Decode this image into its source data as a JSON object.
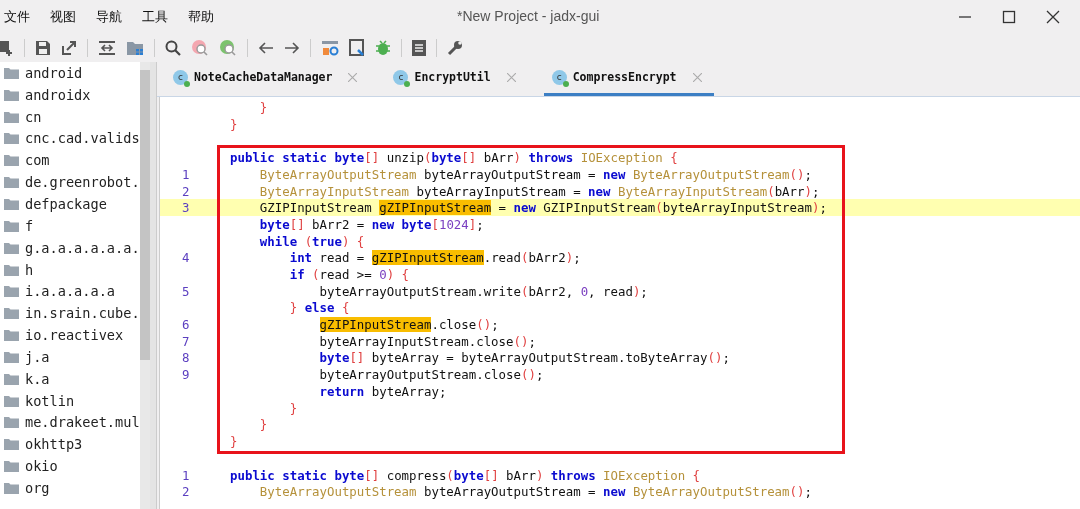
{
  "window": {
    "title": "*New Project - jadx-gui"
  },
  "menu": [
    "文件",
    "视图",
    "导航",
    "工具",
    "帮助"
  ],
  "sidebar": {
    "items": [
      {
        "label": "android"
      },
      {
        "label": "androidx"
      },
      {
        "label": "cn"
      },
      {
        "label": "cnc.cad.valids"
      },
      {
        "label": "com"
      },
      {
        "label": "de.greenrobot."
      },
      {
        "label": "defpackage"
      },
      {
        "label": "f"
      },
      {
        "label": "g.a.a.a.a.a.a."
      },
      {
        "label": "h"
      },
      {
        "label": "i.a.a.a.a.a"
      },
      {
        "label": "in.srain.cube."
      },
      {
        "label": "io.reactivex"
      },
      {
        "label": "j.a"
      },
      {
        "label": "k.a"
      },
      {
        "label": "kotlin"
      },
      {
        "label": "me.drakeet.mul"
      },
      {
        "label": "okhttp3"
      },
      {
        "label": "okio"
      },
      {
        "label": "org"
      }
    ]
  },
  "tabs": [
    {
      "label": "NoteCacheDataManager",
      "icon_letter": "c",
      "selected": false
    },
    {
      "label": "EncryptUtil",
      "icon_letter": "c",
      "selected": false
    },
    {
      "label": "CompressEncrypt",
      "icon_letter": "c",
      "selected": true
    }
  ],
  "code": {
    "lines_before": [
      {
        "current": false,
        "tokens": [
          {
            "kind": "bracket",
            "text": "    }"
          }
        ]
      },
      {
        "current": false,
        "tokens": [
          {
            "kind": "bracket",
            "text": "}"
          }
        ]
      }
    ],
    "annotated_block": {
      "lines": [
        {
          "current": false,
          "tokens": [
            {
              "kind": "keyword",
              "text": "public static byte"
            },
            {
              "kind": "bracket",
              "text": "[]"
            },
            {
              "kind": "plain",
              "text": " unzip"
            },
            {
              "kind": "bracket",
              "text": "("
            },
            {
              "kind": "keyword",
              "text": "byte"
            },
            {
              "kind": "bracket",
              "text": "[]"
            },
            {
              "kind": "plain",
              "text": " bArr"
            },
            {
              "kind": "bracket",
              "text": ")"
            },
            {
              "kind": "keyword",
              "text": " throws"
            },
            {
              "kind": "type",
              "text": " IOException"
            },
            {
              "kind": "bracket",
              "text": " {"
            }
          ]
        },
        {
          "num": "1",
          "current": false,
          "tokens": [
            {
              "kind": "type",
              "text": "    ByteArrayOutputStream"
            },
            {
              "kind": "plain",
              "text": " byteArrayOutputStream = "
            },
            {
              "kind": "keyword",
              "text": "new"
            },
            {
              "kind": "type",
              "text": " ByteArrayOutputStream"
            },
            {
              "kind": "bracket",
              "text": "()"
            },
            {
              "kind": "plain",
              "text": ";"
            }
          ]
        },
        {
          "num": "2",
          "current": false,
          "tokens": [
            {
              "kind": "type",
              "text": "    ByteArrayInputStream"
            },
            {
              "kind": "plain",
              "text": " byteArrayInputStream = "
            },
            {
              "kind": "keyword",
              "text": "new"
            },
            {
              "kind": "type",
              "text": " ByteArrayInputStream"
            },
            {
              "kind": "bracket",
              "text": "("
            },
            {
              "kind": "plain",
              "text": "bArr"
            },
            {
              "kind": "bracket",
              "text": ")"
            },
            {
              "kind": "plain",
              "text": ";"
            }
          ]
        },
        {
          "num": "3",
          "current": true,
          "tokens": [
            {
              "kind": "plain",
              "text": "    GZIPInputStream "
            },
            {
              "kind": "match",
              "text": "gZIPInputStream"
            },
            {
              "kind": "plain",
              "text": " = "
            },
            {
              "kind": "keyword",
              "text": "new"
            },
            {
              "kind": "plain",
              "text": " GZIPInputStream"
            },
            {
              "kind": "bracket",
              "text": "("
            },
            {
              "kind": "plain",
              "text": "byteArrayInputStream"
            },
            {
              "kind": "bracket",
              "text": ")"
            },
            {
              "kind": "plain",
              "text": ";"
            }
          ]
        },
        {
          "current": false,
          "tokens": [
            {
              "kind": "keyword",
              "text": "    byte"
            },
            {
              "kind": "bracket",
              "text": "[]"
            },
            {
              "kind": "plain",
              "text": " bArr2 = "
            },
            {
              "kind": "keyword",
              "text": "new byte"
            },
            {
              "kind": "bracket",
              "text": "["
            },
            {
              "kind": "number",
              "text": "1024"
            },
            {
              "kind": "bracket",
              "text": "]"
            },
            {
              "kind": "plain",
              "text": ";"
            }
          ]
        },
        {
          "current": false,
          "tokens": [
            {
              "kind": "keyword",
              "text": "    while"
            },
            {
              "kind": "bracket",
              "text": " ("
            },
            {
              "kind": "keyword",
              "text": "true"
            },
            {
              "kind": "bracket",
              "text": ") {"
            }
          ]
        },
        {
          "num": "4",
          "current": false,
          "tokens": [
            {
              "kind": "keyword",
              "text": "        int"
            },
            {
              "kind": "plain",
              "text": " read = "
            },
            {
              "kind": "match",
              "text": "gZIPInputStream"
            },
            {
              "kind": "plain",
              "text": ".read"
            },
            {
              "kind": "bracket",
              "text": "("
            },
            {
              "kind": "plain",
              "text": "bArr2"
            },
            {
              "kind": "bracket",
              "text": ")"
            },
            {
              "kind": "plain",
              "text": ";"
            }
          ]
        },
        {
          "current": false,
          "tokens": [
            {
              "kind": "keyword",
              "text": "        if"
            },
            {
              "kind": "bracket",
              "text": " ("
            },
            {
              "kind": "plain",
              "text": "read >= "
            },
            {
              "kind": "number",
              "text": "0"
            },
            {
              "kind": "bracket",
              "text": ") {"
            }
          ]
        },
        {
          "num": "5",
          "current": false,
          "tokens": [
            {
              "kind": "plain",
              "text": "            byteArrayOutputStream.write"
            },
            {
              "kind": "bracket",
              "text": "("
            },
            {
              "kind": "plain",
              "text": "bArr2, "
            },
            {
              "kind": "number",
              "text": "0"
            },
            {
              "kind": "plain",
              "text": ", read"
            },
            {
              "kind": "bracket",
              "text": ")"
            },
            {
              "kind": "plain",
              "text": ";"
            }
          ]
        },
        {
          "current": false,
          "tokens": [
            {
              "kind": "bracket",
              "text": "        }"
            },
            {
              "kind": "keyword",
              "text": " else"
            },
            {
              "kind": "bracket",
              "text": " {"
            }
          ]
        },
        {
          "num": "6",
          "current": false,
          "tokens": [
            {
              "kind": "match",
              "text": "            gZIPInputStream"
            },
            {
              "kind": "plain",
              "text": ".close"
            },
            {
              "kind": "bracket",
              "text": "()"
            },
            {
              "kind": "plain",
              "text": ";"
            }
          ]
        },
        {
          "num": "7",
          "current": false,
          "tokens": [
            {
              "kind": "plain",
              "text": "            byteArrayInputStream.close"
            },
            {
              "kind": "bracket",
              "text": "()"
            },
            {
              "kind": "plain",
              "text": ";"
            }
          ]
        },
        {
          "num": "8",
          "current": false,
          "tokens": [
            {
              "kind": "keyword",
              "text": "            byte"
            },
            {
              "kind": "bracket",
              "text": "[]"
            },
            {
              "kind": "plain",
              "text": " byteArray = byteArrayOutputStream.toByteArray"
            },
            {
              "kind": "bracket",
              "text": "()"
            },
            {
              "kind": "plain",
              "text": ";"
            }
          ]
        },
        {
          "num": "9",
          "current": false,
          "tokens": [
            {
              "kind": "plain",
              "text": "            byteArrayOutputStream.close"
            },
            {
              "kind": "bracket",
              "text": "()"
            },
            {
              "kind": "plain",
              "text": ";"
            }
          ]
        },
        {
          "current": false,
          "tokens": [
            {
              "kind": "keyword",
              "text": "            return"
            },
            {
              "kind": "plain",
              "text": " byteArray;"
            }
          ]
        },
        {
          "current": false,
          "tokens": [
            {
              "kind": "bracket",
              "text": "        }"
            }
          ]
        },
        {
          "current": false,
          "tokens": [
            {
              "kind": "bracket",
              "text": "    }"
            }
          ]
        },
        {
          "current": false,
          "tokens": [
            {
              "kind": "bracket",
              "text": "}"
            }
          ]
        }
      ]
    },
    "lines_after": [
      {
        "num": "1",
        "current": false,
        "tokens": [
          {
            "kind": "keyword",
            "text": "public static byte"
          },
          {
            "kind": "bracket",
            "text": "[]"
          },
          {
            "kind": "plain",
            "text": " compress"
          },
          {
            "kind": "bracket",
            "text": "("
          },
          {
            "kind": "keyword",
            "text": "byte"
          },
          {
            "kind": "bracket",
            "text": "[]"
          },
          {
            "kind": "plain",
            "text": " bArr"
          },
          {
            "kind": "bracket",
            "text": ")"
          },
          {
            "kind": "keyword",
            "text": " throws"
          },
          {
            "kind": "type",
            "text": " IOException"
          },
          {
            "kind": "bracket",
            "text": " {"
          }
        ]
      },
      {
        "num": "2",
        "current": false,
        "tokens": [
          {
            "kind": "type",
            "text": "    ByteArrayOutputStream"
          },
          {
            "kind": "plain",
            "text": " byteArrayOutputStream = "
          },
          {
            "kind": "keyword",
            "text": "new"
          },
          {
            "kind": "type",
            "text": " ByteArrayOutputStream"
          },
          {
            "kind": "bracket",
            "text": "()"
          },
          {
            "kind": "plain",
            "text": ";"
          }
        ]
      }
    ]
  }
}
